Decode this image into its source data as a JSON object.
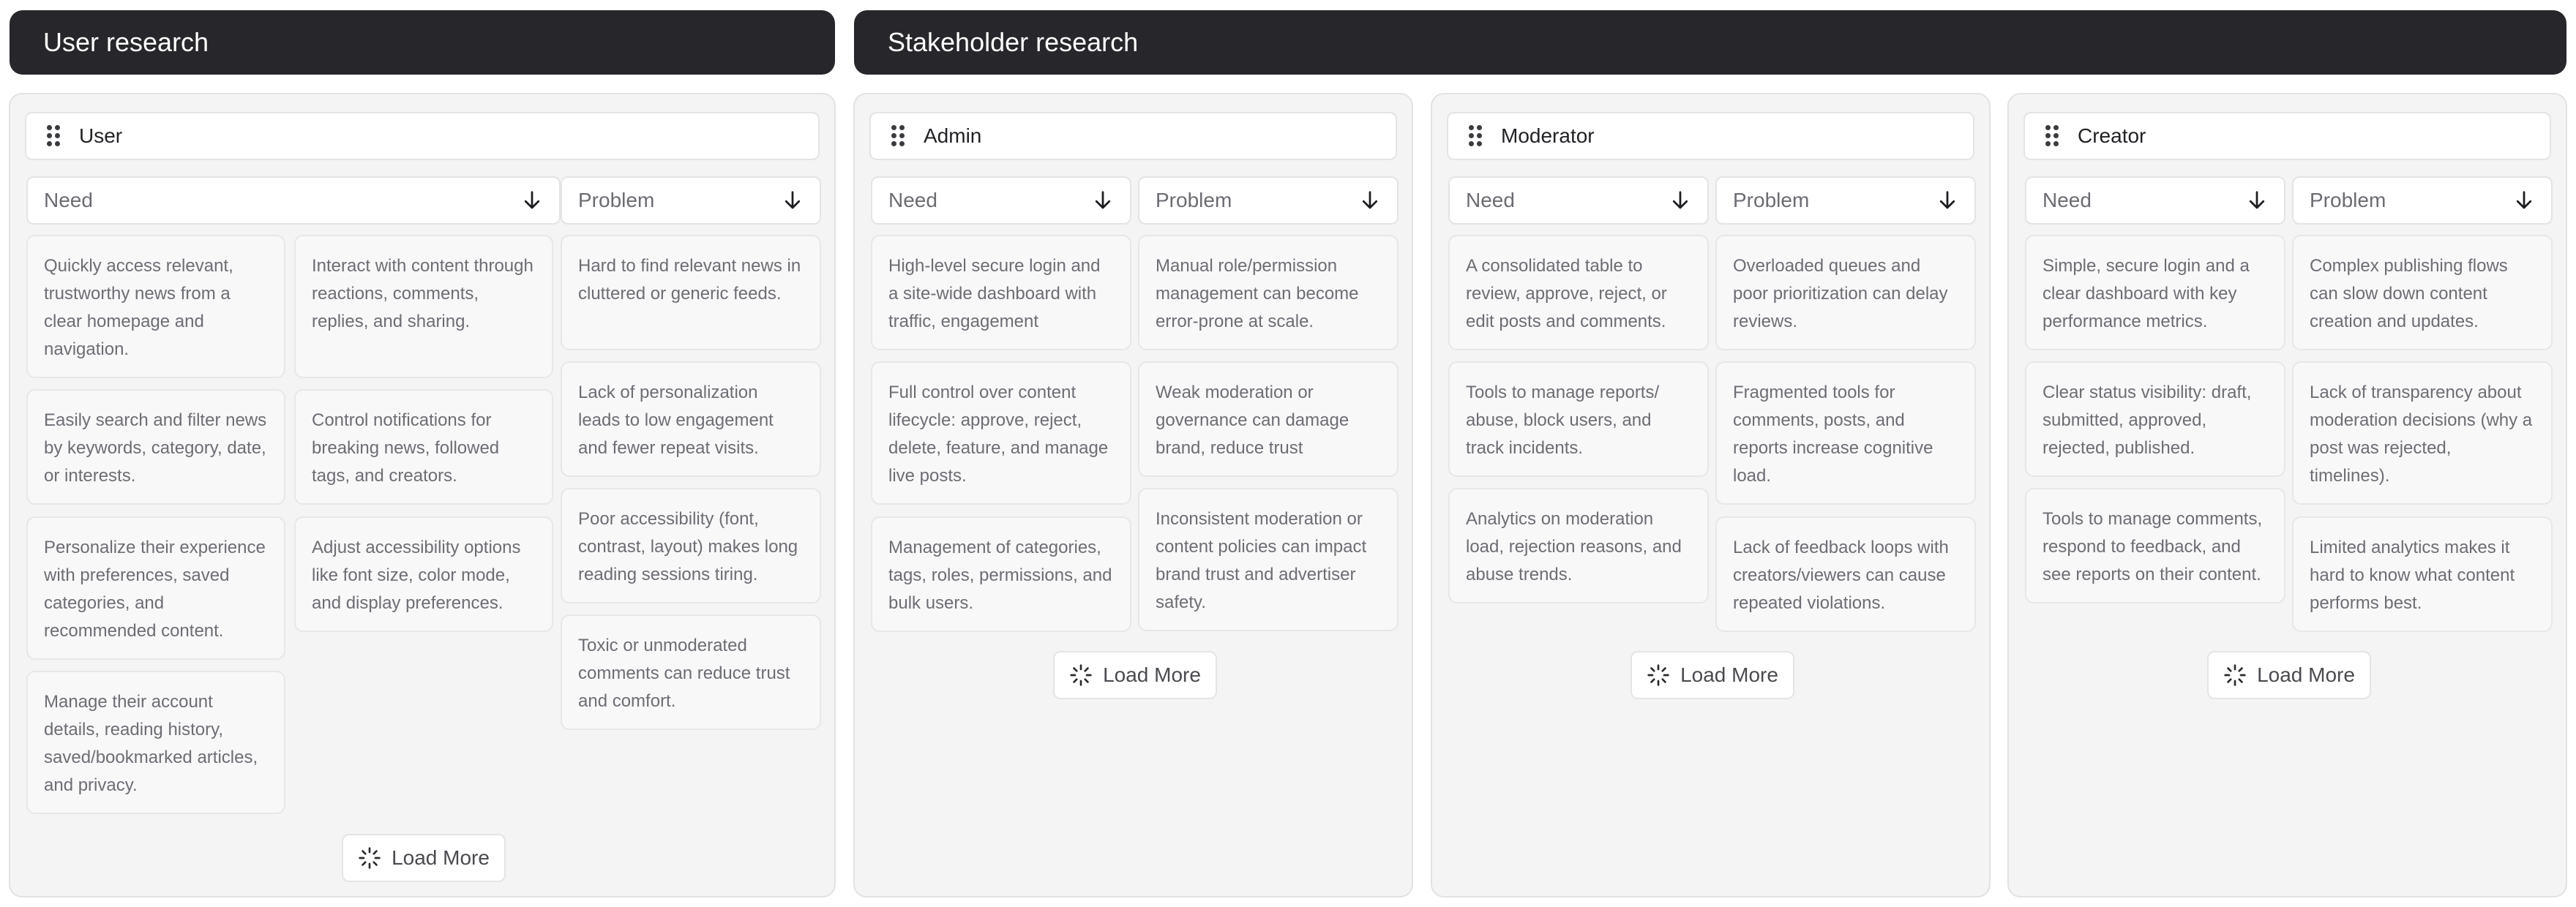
{
  "sections": {
    "user_research": "User research",
    "stakeholder_research": "Stakeholder research"
  },
  "columns": {
    "need": "Need",
    "problem": "Problem"
  },
  "load_more": "Load More",
  "user": {
    "title": "User",
    "needs": [
      "Quickly access relevant, trustworthy news from a clear homepage and navigation.",
      "Easily search and filter news by keywords, category, date, or interests.",
      "Personalize their experience with preferences, saved categories, and recommended content.",
      "Manage their account details, reading history, saved/bookmarked articles, and privacy.",
      "Interact with content through reactions, comments, replies, and sharing.",
      "Control notifications for breaking news, followed tags, and creators.",
      "Adjust accessibility options like font size, color mode, and display preferences."
    ],
    "problems": [
      "Hard to find relevant news in cluttered or generic feeds.",
      "Lack of personalization leads to low engagement and fewer repeat visits.",
      "Poor accessibility (font, contrast, layout) makes long reading sessions tiring.",
      "Toxic or unmoderated comments can reduce trust and comfort."
    ]
  },
  "admin": {
    "title": "Admin",
    "needs": [
      "High-level secure login and a site-wide dashboard with traffic, engagement",
      "Full control over content lifecycle: approve, reject, delete, feature, and manage live posts.",
      "Management of categories, tags, roles, permissions, and bulk users."
    ],
    "problems": [
      "Manual role/permission management can become error-prone at scale.",
      "Weak moderation or governance can damage brand, reduce trust",
      "Inconsistent moderation or content policies can impact brand trust and advertiser safety."
    ]
  },
  "moderator": {
    "title": "Moderator",
    "needs": [
      "A consolidated table to review, approve, reject, or edit posts and comments.",
      "Tools to manage reports/ abuse, block users, and track incidents.",
      "Analytics on moderation load, rejection reasons, and abuse trends."
    ],
    "problems": [
      "Overloaded queues and poor prioritization can delay reviews.",
      "Fragmented tools for comments, posts, and reports increase cognitive load.",
      "Lack of feedback loops with creators/viewers can cause repeated violations."
    ]
  },
  "creator": {
    "title": "Creator",
    "needs": [
      "Simple, secure login and a clear dashboard with key performance metrics.",
      "Clear status visibility: draft, submitted, approved, rejected, published.",
      "Tools to manage comments, respond to feedback, and see reports on their content."
    ],
    "problems": [
      "Complex publishing flows can slow down content creation and updates.",
      "Lack of transparency about moderation decisions (why a post was rejected, timelines).",
      "Limited analytics makes it hard to know what content performs best."
    ]
  }
}
